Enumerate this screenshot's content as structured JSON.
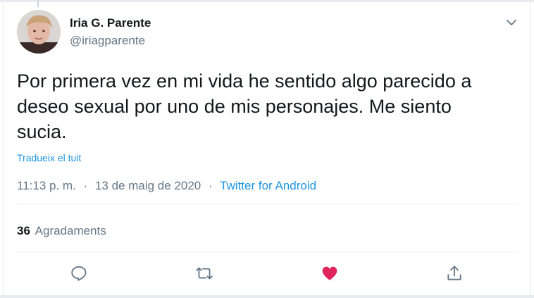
{
  "tweet": {
    "author": {
      "name": "Iria G. Parente",
      "handle": "@iriagparente"
    },
    "text": "Por primera vez en mi vida he sentido algo parecido a\ndeseo sexual por uno de mis personajes. Me siento\nsucia.",
    "translate_label": "Tradueix el tuit",
    "time": "11:13 p. m.",
    "separator": "·",
    "date": "13 de maig de 2020",
    "source": "Twitter for Android",
    "likes_count": "36",
    "likes_label": "Agradaments",
    "liked": true
  },
  "icons": {
    "more": "chevron-down-icon",
    "reply": "reply-icon",
    "retweet": "retweet-icon",
    "like": "heart-icon",
    "share": "share-icon"
  },
  "colors": {
    "text": "#14171a",
    "secondary": "#657786",
    "link": "#1b95e0",
    "like": "#e0245e",
    "divider": "#e6ecf0"
  }
}
